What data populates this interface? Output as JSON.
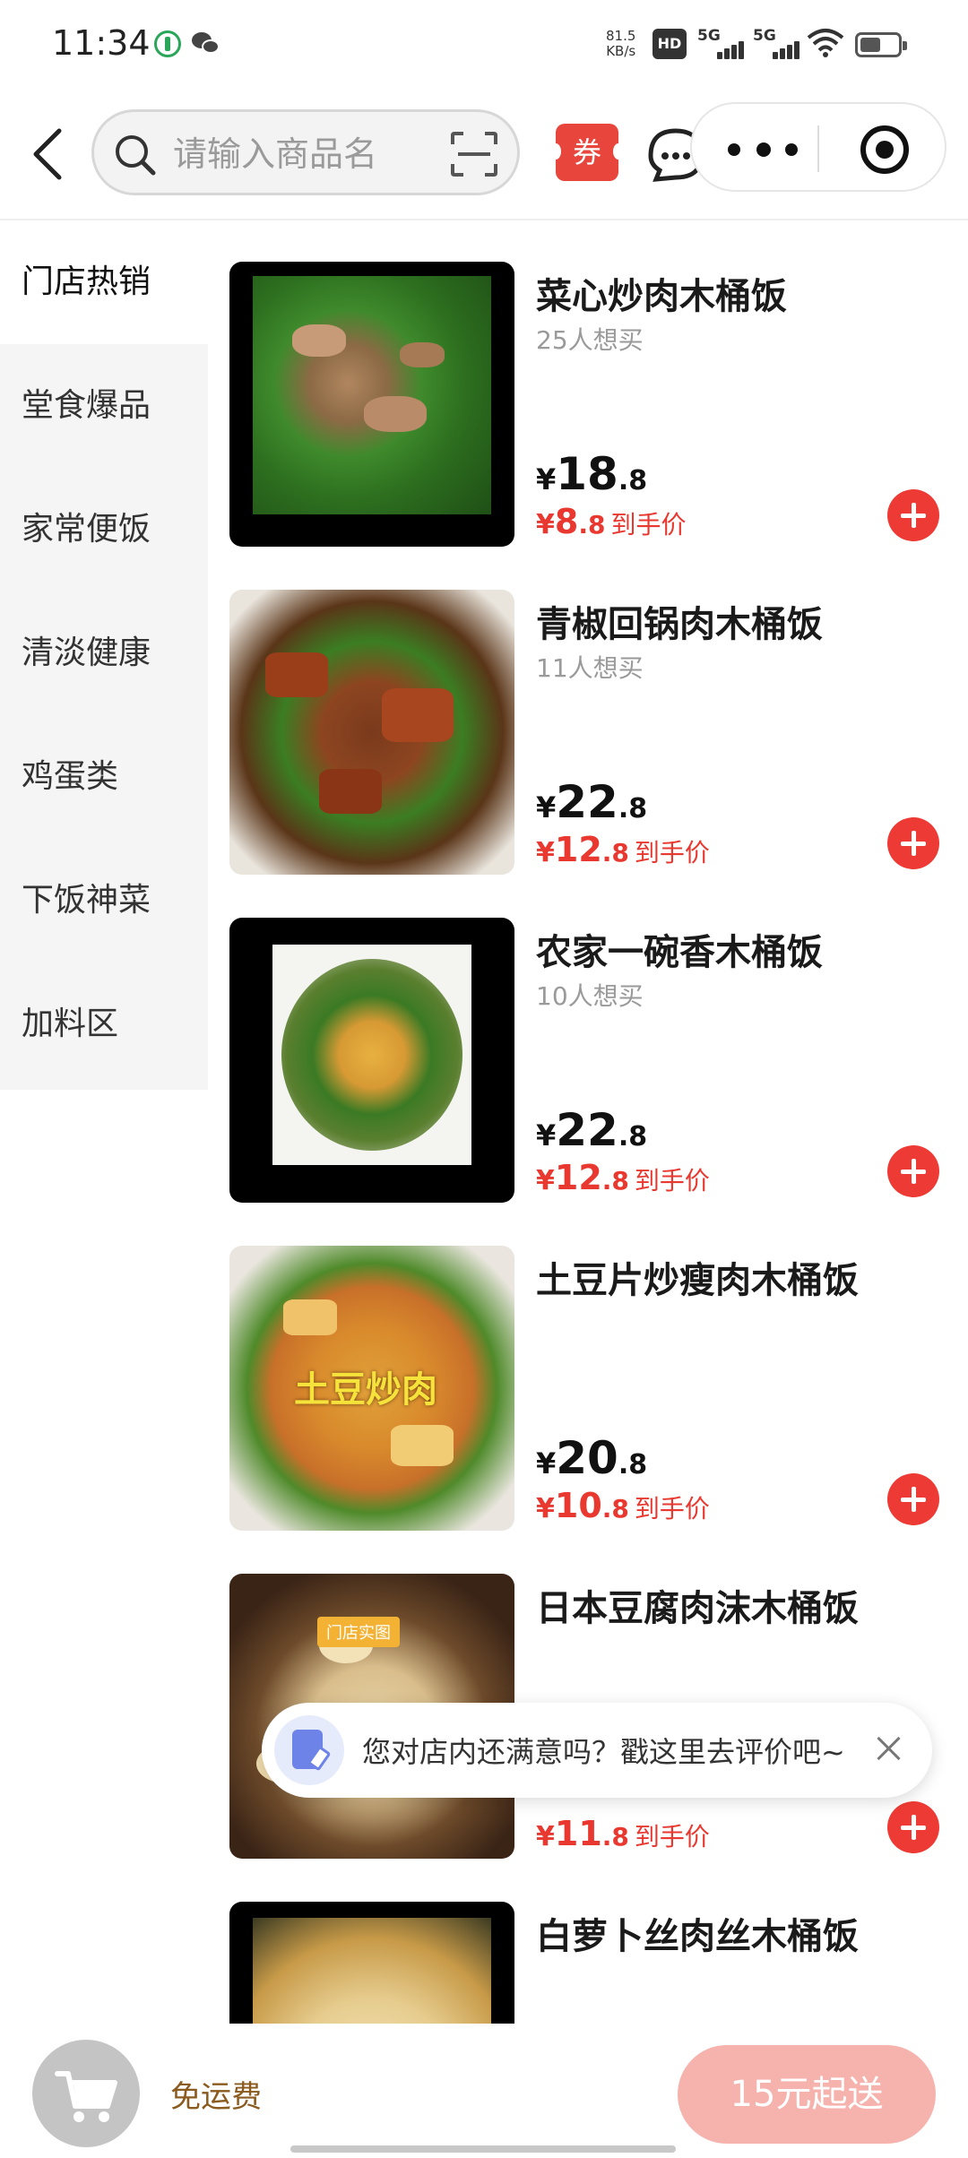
{
  "status_bar": {
    "time": "11:34",
    "net_speed_value": "81.5",
    "net_speed_unit": "KB/s",
    "hd_label": "HD",
    "sim1_label": "5G",
    "sim2_label": "5G"
  },
  "nav": {
    "search_placeholder": "请输入商品名",
    "coupon_label": "券"
  },
  "sidebar": {
    "items": [
      {
        "label": "门店热销",
        "active": true
      },
      {
        "label": "堂食爆品",
        "active": false
      },
      {
        "label": "家常便饭",
        "active": false
      },
      {
        "label": "清淡健康",
        "active": false
      },
      {
        "label": "鸡蛋类",
        "active": false
      },
      {
        "label": "下饭神菜",
        "active": false
      },
      {
        "label": "加料区",
        "active": false
      }
    ]
  },
  "products": [
    {
      "name": "菜心炒肉木桶饭",
      "want": "25人想买",
      "currency": "¥",
      "price_int": "18",
      "price_dec": ".8",
      "final_int": "8",
      "final_dec": ".8",
      "final_label": "到手价"
    },
    {
      "name": "青椒回锅肉木桶饭",
      "want": "11人想买",
      "currency": "¥",
      "price_int": "22",
      "price_dec": ".8",
      "final_int": "12",
      "final_dec": ".8",
      "final_label": "到手价"
    },
    {
      "name": "农家一碗香木桶饭",
      "want": "10人想买",
      "currency": "¥",
      "price_int": "22",
      "price_dec": ".8",
      "final_int": "12",
      "final_dec": ".8",
      "final_label": "到手价"
    },
    {
      "name": "土豆片炒瘦肉木桶饭",
      "want": "",
      "currency": "¥",
      "price_int": "20",
      "price_dec": ".8",
      "final_int": "10",
      "final_dec": ".8",
      "final_label": "到手价",
      "image_caption": "土豆炒肉"
    },
    {
      "name": "日本豆腐肉沫木桶饭",
      "want": "",
      "currency": "¥",
      "price_int": "",
      "price_dec": "",
      "final_int": "11",
      "final_dec": ".8",
      "final_label": "到手价",
      "image_badge": "门店实图"
    },
    {
      "name": "白萝卜丝肉丝木桶饭",
      "want": "",
      "currency": "",
      "price_int": "",
      "price_dec": "",
      "final_int": "",
      "final_dec": "",
      "final_label": ""
    }
  ],
  "review_popup": {
    "text": "您对店内还满意吗？戳这里去评价吧~"
  },
  "bottom_bar": {
    "free_shipping": "免运费",
    "min_order": "15元起送"
  },
  "colors": {
    "accent_red": "#e8382f",
    "add_button": "#ee3a34",
    "min_order_bg": "#f6b3ad",
    "free_ship_text": "#8a5a1e"
  }
}
